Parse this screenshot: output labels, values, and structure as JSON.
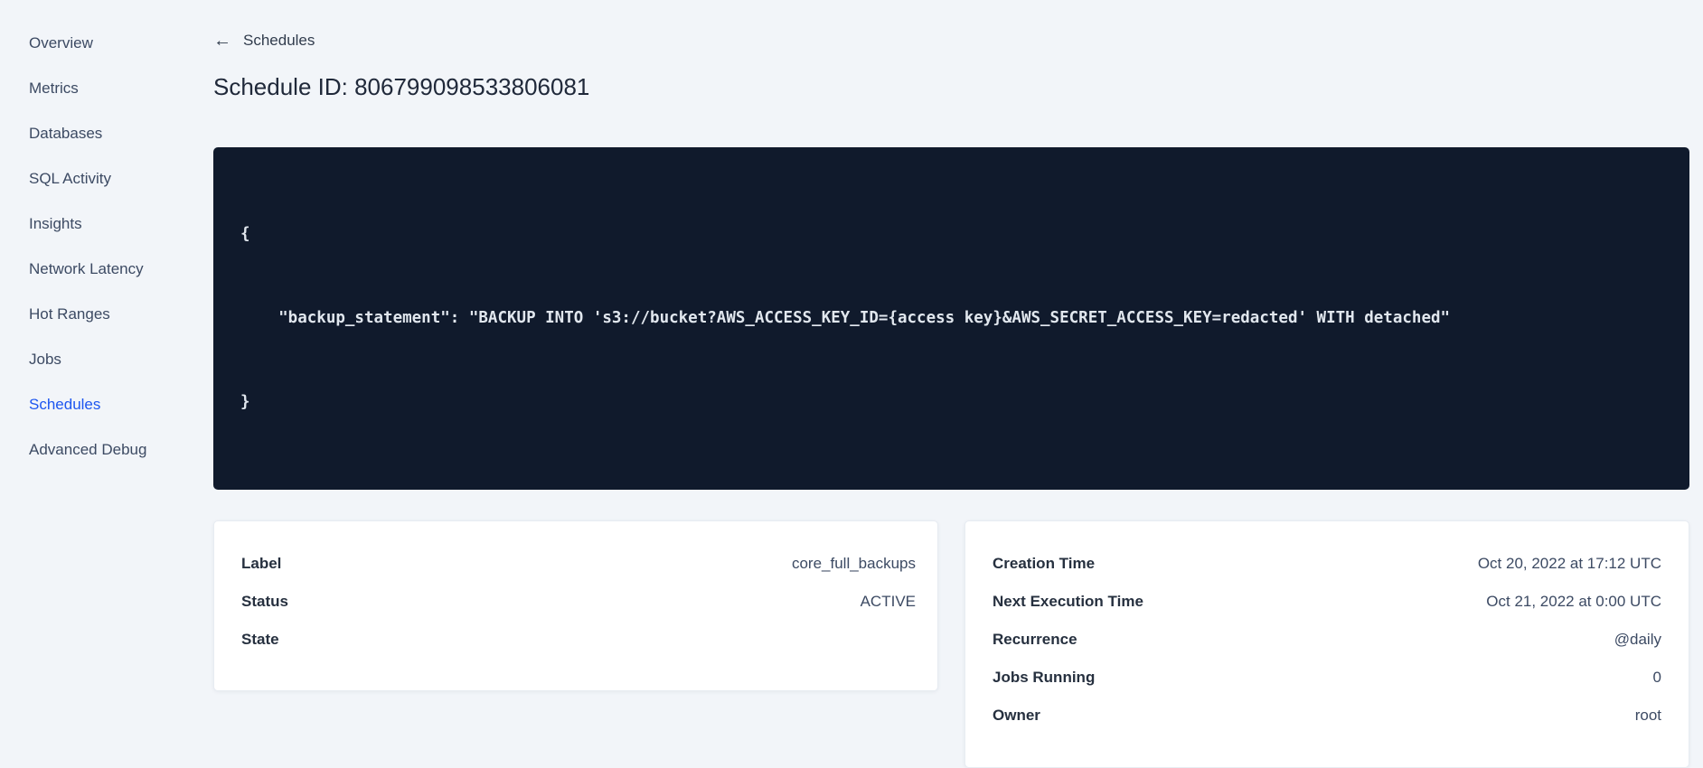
{
  "sidebar": {
    "items": [
      {
        "label": "Overview",
        "active": false
      },
      {
        "label": "Metrics",
        "active": false
      },
      {
        "label": "Databases",
        "active": false
      },
      {
        "label": "SQL Activity",
        "active": false
      },
      {
        "label": "Insights",
        "active": false
      },
      {
        "label": "Network Latency",
        "active": false
      },
      {
        "label": "Hot Ranges",
        "active": false
      },
      {
        "label": "Jobs",
        "active": false
      },
      {
        "label": "Schedules",
        "active": true
      },
      {
        "label": "Advanced Debug",
        "active": false
      }
    ]
  },
  "header": {
    "back_icon": "arrow-left",
    "back_label": "Schedules",
    "title": "Schedule ID: 806799098533806081"
  },
  "code_block": {
    "lines": [
      "{",
      "    \"backup_statement\": \"BACKUP INTO 's3://bucket?AWS_ACCESS_KEY_ID={access key}&AWS_SECRET_ACCESS_KEY=redacted' WITH detached\"",
      "}"
    ]
  },
  "details_card": {
    "rows": [
      {
        "label": "Label",
        "value": "core_full_backups"
      },
      {
        "label": "Status",
        "value": "ACTIVE"
      },
      {
        "label": "State",
        "value": ""
      }
    ]
  },
  "schedule_card": {
    "rows": [
      {
        "label": "Creation Time",
        "value": "Oct 20, 2022 at 17:12 UTC"
      },
      {
        "label": "Next Execution Time",
        "value": "Oct 21, 2022 at 0:00 UTC"
      },
      {
        "label": "Recurrence",
        "value": "@daily"
      },
      {
        "label": "Jobs Running",
        "value": "0"
      },
      {
        "label": "Owner",
        "value": "root"
      }
    ]
  },
  "colors": {
    "accent_blue": "#1d56f0",
    "code_background": "#101a2c",
    "page_background": "#f2f5f9",
    "heading_text": "#20293a"
  }
}
